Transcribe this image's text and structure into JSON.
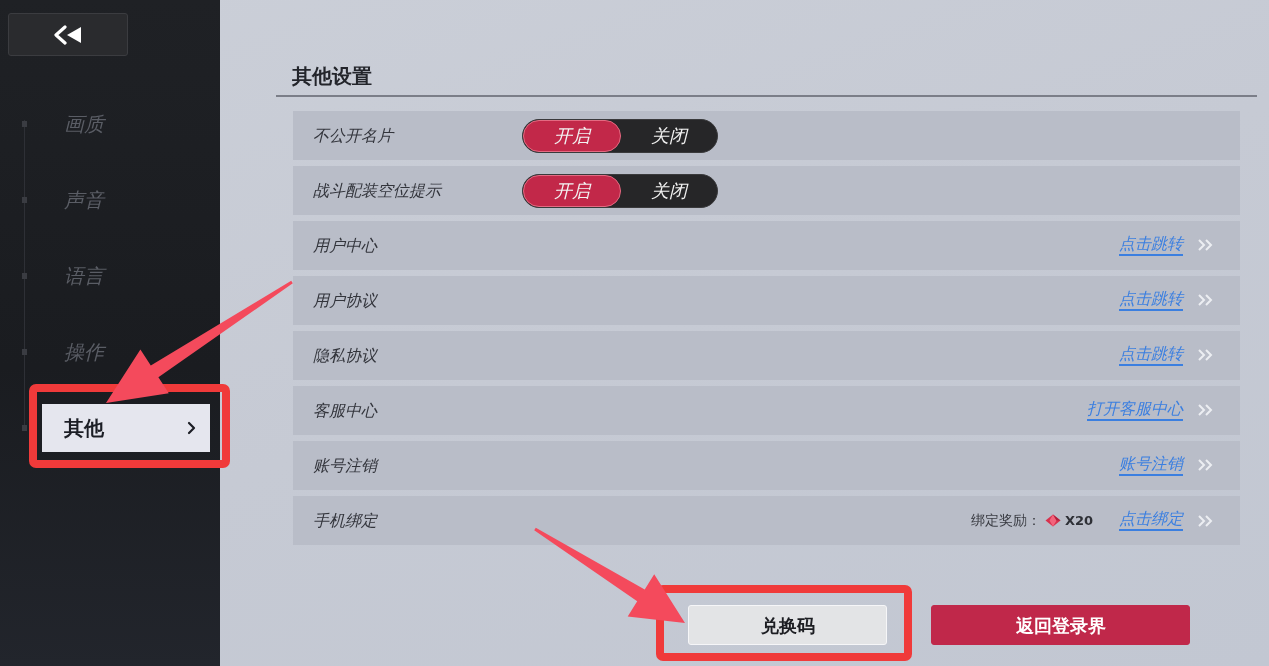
{
  "sidebar": {
    "items": [
      {
        "label": "画质",
        "selected": false,
        "highlighted": false
      },
      {
        "label": "声音",
        "selected": false,
        "highlighted": false
      },
      {
        "label": "语言",
        "selected": false,
        "highlighted": false
      },
      {
        "label": "操作",
        "selected": false,
        "highlighted": false
      },
      {
        "label": "其他",
        "selected": true,
        "highlighted": true
      }
    ]
  },
  "section": {
    "title": "其他设置"
  },
  "settings": [
    {
      "kind": "toggle",
      "label": "不公开名片",
      "options": [
        {
          "label": "开启",
          "selected": true
        },
        {
          "label": "关闭",
          "selected": false
        }
      ]
    },
    {
      "kind": "toggle",
      "label": "战斗配装空位提示",
      "options": [
        {
          "label": "开启",
          "selected": true
        },
        {
          "label": "关闭",
          "selected": false
        }
      ]
    },
    {
      "kind": "link",
      "label": "用户中心",
      "link": "点击跳转"
    },
    {
      "kind": "link",
      "label": "用户协议",
      "link": "点击跳转"
    },
    {
      "kind": "link",
      "label": "隐私协议",
      "link": "点击跳转"
    },
    {
      "kind": "link",
      "label": "客服中心",
      "link": "打开客服中心"
    },
    {
      "kind": "link",
      "label": "账号注销",
      "link": "账号注销"
    },
    {
      "kind": "link",
      "label": "手机绑定",
      "reward": {
        "label": "绑定奖励：",
        "amount": "X20"
      },
      "link": "点击绑定"
    }
  ],
  "buttons": [
    {
      "label": "兑换码",
      "kind": "secondary",
      "highlighted": true
    },
    {
      "label": "返回登录界",
      "kind": "primary",
      "highlighted": false
    }
  ]
}
